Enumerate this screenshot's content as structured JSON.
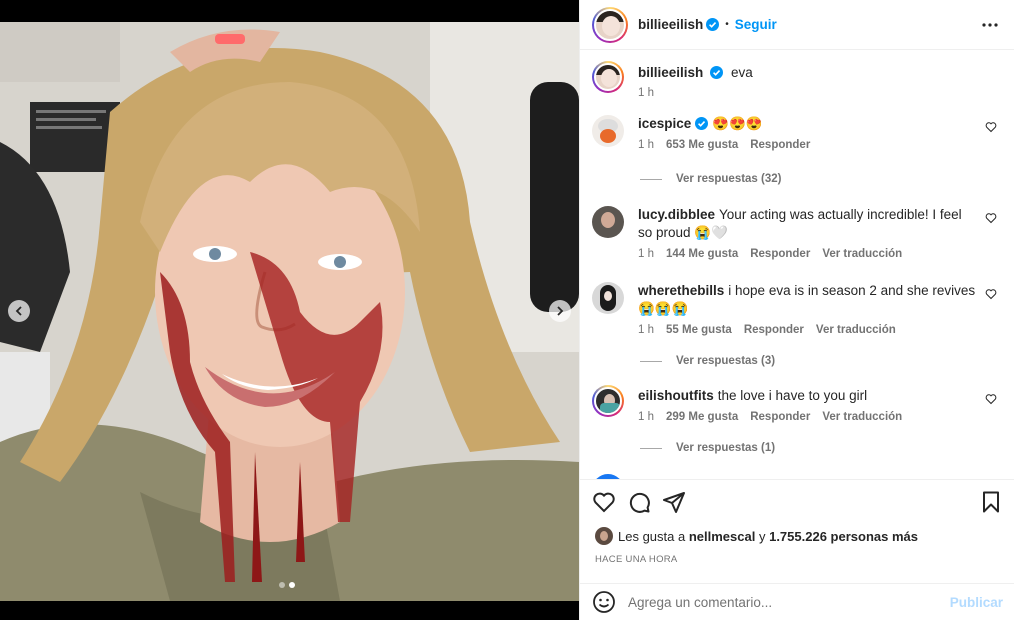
{
  "post": {
    "username": "billieeilish",
    "follow_label": "Seguir",
    "separator": "•",
    "caption": "eva",
    "caption_time": "1 h"
  },
  "comments": [
    {
      "user": "icespice",
      "verified": true,
      "text": "😍😍😍",
      "time": "1 h",
      "likes": "653 Me gusta",
      "reply": "Responder",
      "translate": "",
      "view_replies": "Ver respuestas (32)"
    },
    {
      "user": "lucy.dibblee",
      "verified": false,
      "text": "Your acting was actually incredible! I feel so proud 😭🤍",
      "time": "1 h",
      "likes": "144 Me gusta",
      "reply": "Responder",
      "translate": "Ver traducción",
      "view_replies": ""
    },
    {
      "user": "wherethebills",
      "verified": false,
      "text": "i hope eva is in season 2 and she revives😭😭😭",
      "time": "1 h",
      "likes": "55 Me gusta",
      "reply": "Responder",
      "translate": "Ver traducción",
      "view_replies": "Ver respuestas (3)"
    },
    {
      "user": "eilishoutfits",
      "verified": false,
      "text": "the love i have to you girl",
      "time": "1 h",
      "likes": "299 Me gusta",
      "reply": "Responder",
      "translate": "Ver traducción",
      "view_replies": "Ver respuestas (1)"
    }
  ],
  "likes": {
    "prefix": "Les gusta a",
    "user": "nellmescal",
    "joiner": "y",
    "others": "1.755.226 personas más"
  },
  "posted_time": "HACE UNA HORA",
  "add_comment": {
    "placeholder": "Agrega un comentario...",
    "publish": "Publicar"
  },
  "icons": {
    "verified": "verified-badge-icon",
    "more": "more-options-icon",
    "like": "heart-icon",
    "comment": "comment-bubble-icon",
    "share": "send-icon",
    "save": "bookmark-icon",
    "emoji": "emoji-icon"
  },
  "colors": {
    "accent": "#0095f6",
    "publish_disabled": "#b3dbff",
    "muted_text": "#737373",
    "text": "#262626"
  }
}
